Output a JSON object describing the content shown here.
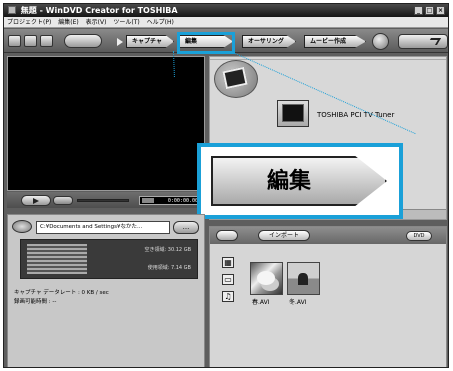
{
  "window": {
    "title": "無題 - WinDVD Creator for TOSHIBA",
    "controls": [
      "_",
      "□",
      "×"
    ]
  },
  "menu": {
    "items": [
      "プロジェクト(P)",
      "編集(E)",
      "表示(V)",
      "ツール(T)",
      "ヘルプ(H)"
    ]
  },
  "toolbar": {
    "modes": [
      {
        "label": "キャプチャ",
        "active": false
      },
      {
        "label": "編集",
        "active": true
      },
      {
        "label": "オーサリング",
        "active": false
      },
      {
        "label": "ムービー作成",
        "active": false
      }
    ]
  },
  "player": {
    "time": "0:00:00.00"
  },
  "source": {
    "tuner_label": "TOSHIBA PCI TV Tuner"
  },
  "callout": {
    "label": "編集",
    "highlight_color": "#1aa0d8"
  },
  "capture": {
    "path": "C:¥Documents and Settings¥なかた...",
    "folder_button": "...",
    "free_space": "空き領域: 30.12 GB",
    "used_space": "使用領域: 7.14 GB",
    "data_rate": "キャプチャ データレート : 0 KB / sec",
    "time_available": "録画可能時間 : --"
  },
  "library": {
    "import_label": "インポート",
    "dvd_label": "DVD",
    "items": [
      {
        "name": "春.AVI"
      },
      {
        "name": "冬.AVI"
      }
    ]
  }
}
